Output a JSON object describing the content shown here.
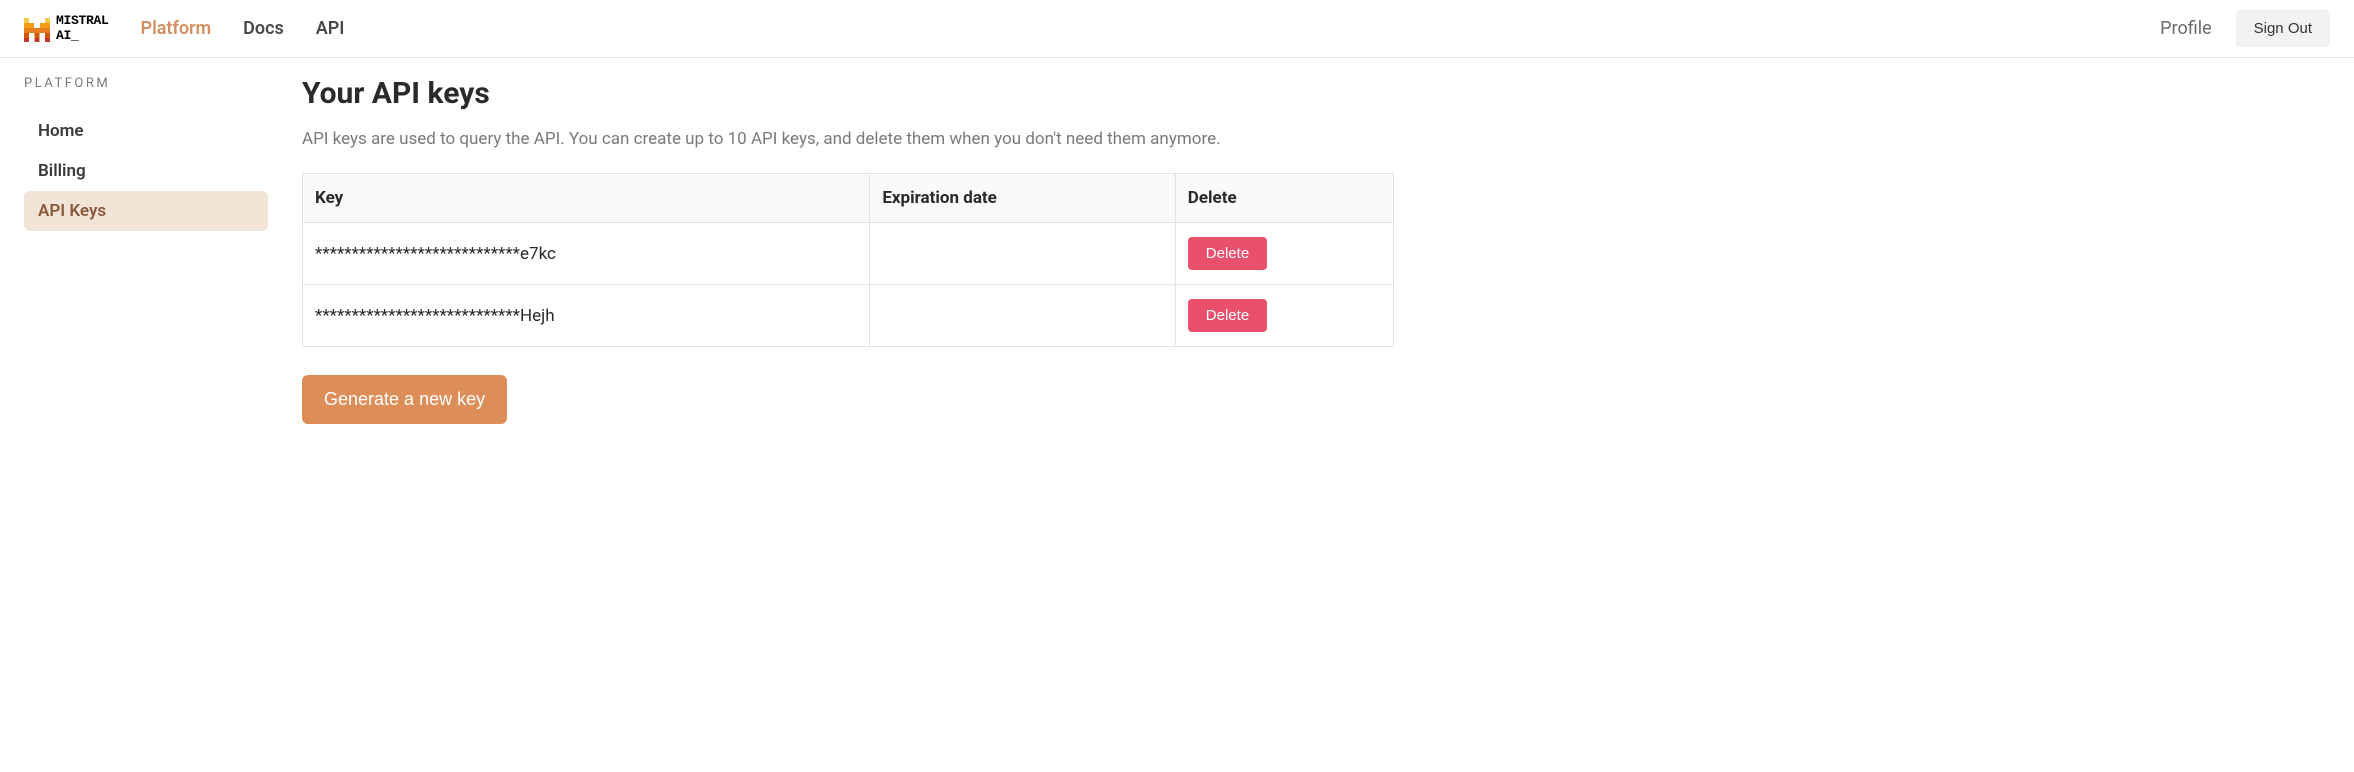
{
  "brand": {
    "name_line1": "MISTRAL",
    "name_line2": "AI_"
  },
  "nav": {
    "items": [
      {
        "label": "Platform",
        "active": true
      },
      {
        "label": "Docs",
        "active": false
      },
      {
        "label": "API",
        "active": false
      }
    ]
  },
  "topbar": {
    "profile_label": "Profile",
    "signout_label": "Sign Out"
  },
  "sidebar": {
    "title": "PLATFORM",
    "items": [
      {
        "label": "Home",
        "active": false
      },
      {
        "label": "Billing",
        "active": false
      },
      {
        "label": "API Keys",
        "active": true
      }
    ]
  },
  "page": {
    "title": "Your API keys",
    "description": "API keys are used to query the API. You can create up to 10 API keys, and delete them when you don't need them anymore."
  },
  "table": {
    "columns": {
      "key": "Key",
      "expiration": "Expiration date",
      "delete": "Delete"
    },
    "rows": [
      {
        "key": "****************************e7kc",
        "expiration": "",
        "delete_label": "Delete"
      },
      {
        "key": "****************************Hejh",
        "expiration": "",
        "delete_label": "Delete"
      }
    ]
  },
  "actions": {
    "generate_label": "Generate a new key"
  }
}
